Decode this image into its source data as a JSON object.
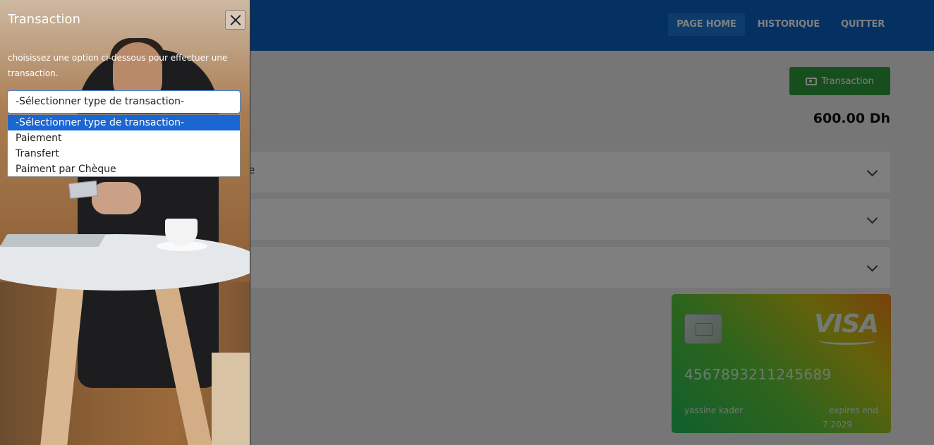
{
  "nav": {
    "items": [
      {
        "label": "PAGE HOME",
        "active": true
      },
      {
        "label": "HISTORIQUE",
        "active": false
      },
      {
        "label": "QUITTER",
        "active": false
      }
    ]
  },
  "main": {
    "transaction_button": "Transaction",
    "balance": "600.00 Dh",
    "accordion_stray_text": "e"
  },
  "card": {
    "brand": "VISA",
    "number": "4567893211245689",
    "holder": "yassine kader",
    "expires_label": "expires end",
    "expires_value": "7 2029"
  },
  "panel": {
    "title": "Transaction",
    "description": "choisissez une option ci-dessous pour effectuer une transaction.",
    "select_value": "-Sélectionner type de transaction-",
    "options": [
      "-Sélectionner type de transaction-",
      "Paiement",
      "Transfert",
      "Paiment par Chèque"
    ]
  },
  "colors": {
    "brand_blue": "#0a62c4",
    "transaction_green": "#2e9c3c",
    "option_highlight": "#1a67d3"
  }
}
